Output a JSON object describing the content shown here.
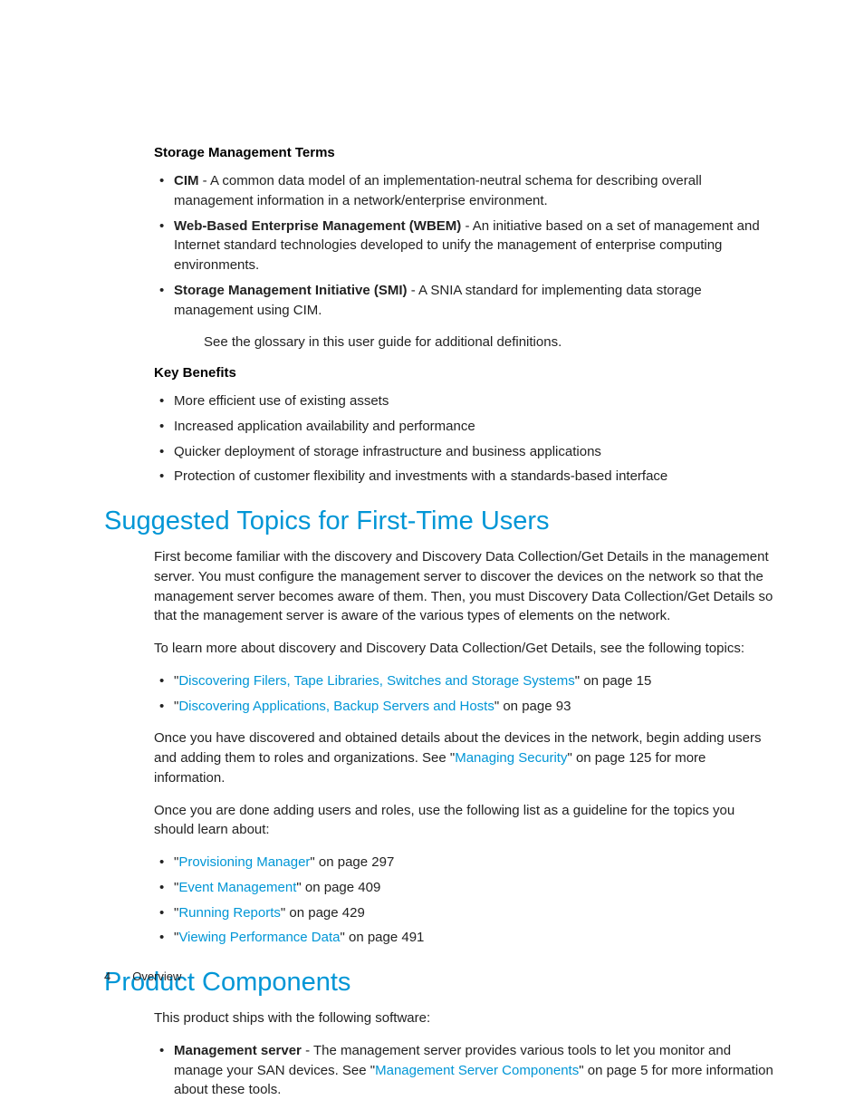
{
  "terms_heading": "Storage Management Terms",
  "terms": [
    {
      "name": "CIM",
      "desc": " - A common data model of an implementation-neutral schema for describing overall management information in a network/enterprise environment."
    },
    {
      "name": "Web-Based Enterprise Management (WBEM)",
      "desc": " - An initiative based on a set of management and Internet standard technologies developed to unify the management of enterprise computing environments."
    },
    {
      "name": "Storage Management Initiative (SMI)",
      "desc": " - A SNIA standard for implementing data storage management using CIM."
    }
  ],
  "glossary_note": "See the glossary in this user guide for additional definitions.",
  "benefits_heading": "Key Benefits",
  "benefits": [
    "More efficient use of existing assets",
    "Increased application availability and performance",
    "Quicker deployment of storage infrastructure and business applications",
    "Protection of customer flexibility and investments with a standards-based interface"
  ],
  "section1": {
    "title": "Suggested Topics for First-Time Users",
    "p1": "First become familiar with the discovery and Discovery Data Collection/Get Details in the management server. You must configure the management server to discover the devices on the network so that the management server becomes aware of them. Then, you must Discovery Data Collection/Get Details so that the management server is aware of the various types of elements on the network.",
    "p2": "To learn more about discovery and Discovery Data Collection/Get Details, see the following topics:",
    "links1": [
      {
        "pre": "\"",
        "link": "Discovering Filers, Tape Libraries, Switches and Storage Systems",
        "post": "\" on page 15"
      },
      {
        "pre": "\"",
        "link": "Discovering Applications, Backup Servers and Hosts",
        "post": "\" on page 93"
      }
    ],
    "p3_pre": "Once you have discovered and obtained details about the devices in the network, begin adding users and adding them to roles and organizations. See \"",
    "p3_link": "Managing Security",
    "p3_post": "\" on page 125 for more information.",
    "p4": "Once you are done adding users and roles, use the following list as a guideline for the topics you should learn about:",
    "links2": [
      {
        "pre": "\"",
        "link": "Provisioning Manager",
        "post": "\" on page 297"
      },
      {
        "pre": "\"",
        "link": "Event Management",
        "post": "\" on page 409"
      },
      {
        "pre": "\"",
        "link": "Running Reports",
        "post": "\" on page 429"
      },
      {
        "pre": "\"",
        "link": "Viewing Performance Data",
        "post": "\" on page 491"
      }
    ]
  },
  "section2": {
    "title": "Product Components",
    "p1": "This product ships with the following software:",
    "item_name": "Management server",
    "item_pre": " - The management server provides various tools to let you monitor and manage your SAN devices. See \"",
    "item_link": "Management Server Components",
    "item_post": "\" on page 5 for more information about these tools."
  },
  "footer": {
    "page": "4",
    "chapter": "Overview"
  }
}
